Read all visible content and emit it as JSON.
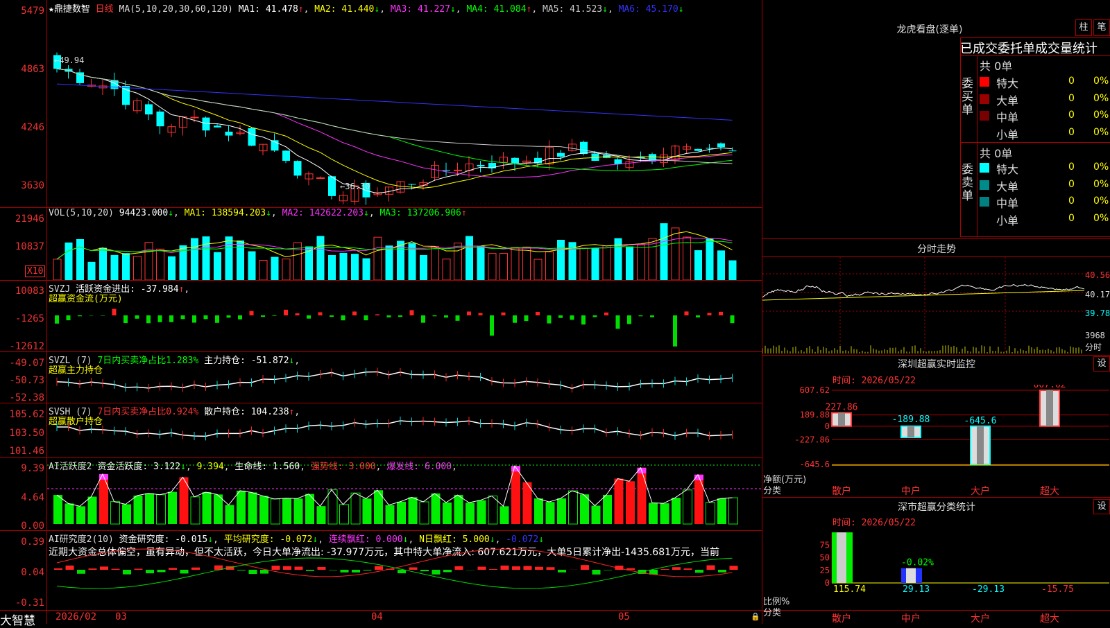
{
  "stock": {
    "name": "★鼎捷数智",
    "period": "日线",
    "ma_label": "MA(5,10,20,30,60,120)"
  },
  "ma": {
    "ma1": "MA1: 41.478",
    "ma2": "MA2: 41.440",
    "ma3": "MA3: 41.227",
    "ma4": "MA4: 41.084",
    "ma5": "MA5: 41.523",
    "ma6": "MA6: 45.170",
    "colors": {
      "ma1": "#ffffff",
      "ma2": "#ffff00",
      "ma3": "#ff33ff",
      "ma4": "#00ff00",
      "ma5": "#cccccc",
      "ma6": "#3333ff"
    }
  },
  "price_axis": [
    "5479",
    "4863",
    "4246",
    "3630"
  ],
  "price_annotations": {
    "high": "49.94",
    "low": "36.30"
  },
  "vol": {
    "header": "VOL(5,10,20)",
    "value": "94423.000",
    "ma1": "MA1: 138594.203",
    "ma2": "MA2: 142622.203",
    "ma3": "MA3: 137206.906",
    "axis": [
      "21946",
      "10837"
    ],
    "unit": "X10"
  },
  "svzj": {
    "header": "SVZJ",
    "label": "活跃资金进出: -37.984",
    "sublabel": "超赢资金流(万元)",
    "axis": [
      "10083",
      "-1265",
      "-12612"
    ]
  },
  "svzl": {
    "header": "SVZL (7)",
    "label1": "7日内买卖净占比1.283%",
    "label2": "主力持仓: -51.872",
    "sublabel": "超赢主力持仓",
    "axis": [
      "-49.07",
      "-50.73",
      "-52.38"
    ]
  },
  "svsh": {
    "header": "SVSH (7)",
    "label1": "7日内买卖净占比0.924%",
    "label2": "散户持仓: 104.238",
    "sublabel": "超赢散户持仓",
    "axis": [
      "105.62",
      "103.50",
      "101.46"
    ]
  },
  "ai_active": {
    "header": "AI活跃度2",
    "label": "资金活跃度: 3.122",
    "v2": "9.394",
    "life": "生命线: 1.560",
    "strong": "强势线: 3.000",
    "burst": "爆发线: 6.000",
    "axis": [
      "9.39",
      "4.64",
      "0.00"
    ]
  },
  "ai_research": {
    "header": "AI研究度2(10)",
    "label": "资金研究度: -0.015",
    "avg": "平均研究度: -0.072",
    "red": "连续飘红: 0.000",
    "nred": "N日飘红: 5.000",
    "extra": "-0.072",
    "comment": "近期大资金总体偏空，虽有异动，但不太活跃，今日大单净流出: -37.977万元，其中特大单净流入: 607.621万元，大单5日累计净出-1435.681万元，当前",
    "axis": [
      "0.39",
      "0.04",
      "-0.31"
    ]
  },
  "date_axis": {
    "brand": "大智慧",
    "labels": [
      "2026/02",
      "03",
      "04",
      "05"
    ]
  },
  "dragon": {
    "title": "龙虎看盘(逐单)",
    "tab1": "柱",
    "tab2": "笔",
    "subtitle": "已成交委托单成交量统计",
    "buy": {
      "side": "委买单",
      "total": "共 0单",
      "rows": [
        {
          "label": "特大",
          "count": "0",
          "pct": "0%",
          "color": "#ff0000"
        },
        {
          "label": "大单",
          "count": "0",
          "pct": "0%",
          "color": "#990000"
        },
        {
          "label": "中单",
          "count": "0",
          "pct": "0%",
          "color": "#770000"
        },
        {
          "label": "小单",
          "count": "0",
          "pct": "0%",
          "color": ""
        }
      ]
    },
    "sell": {
      "side": "委卖单",
      "total": "共 0单",
      "rows": [
        {
          "label": "特大",
          "count": "0",
          "pct": "0%",
          "color": "#00ffff"
        },
        {
          "label": "大单",
          "count": "0",
          "pct": "0%",
          "color": "#008b8b"
        },
        {
          "label": "中单",
          "count": "0",
          "pct": "0%",
          "color": "#008080"
        },
        {
          "label": "小单",
          "count": "0",
          "pct": "0%",
          "color": ""
        }
      ]
    }
  },
  "intraday": {
    "title": "分时走势",
    "axis": [
      "40.56",
      "40.17",
      "39.78"
    ],
    "vol_axis": "3968",
    "vol_unit": "分时"
  },
  "realtime": {
    "title": "深圳超赢实时监控",
    "settings": "设",
    "time": "时间: 2026/05/22",
    "axis": [
      "607.62",
      "189.88",
      "0",
      "-227.86",
      "-645.6"
    ],
    "ylabel": "净额(万元)",
    "xlabel": "分类",
    "chart_data": {
      "type": "bar",
      "categories": [
        "散户",
        "中户",
        "大户",
        "超大"
      ],
      "values": [
        227.86,
        -189.88,
        -645.6,
        607.62
      ],
      "labels": [
        "227.86",
        "-189.88",
        "-645.6",
        "607.62"
      ],
      "ylim": [
        -645.6,
        607.62
      ]
    }
  },
  "classify": {
    "title": "深市超赢分类统计",
    "settings": "设",
    "time": "时间: 2026/05/22",
    "axis": [
      "75",
      "50",
      "25",
      "0"
    ],
    "ylabel": "比例%",
    "xlabel": "分类",
    "chart_data": {
      "type": "bar",
      "categories": [
        "散户",
        "中户",
        "大户",
        "超大"
      ],
      "values": [
        115.74,
        29.13,
        -29.13,
        -15.75
      ],
      "labels": [
        "115.74",
        "29.13",
        "-29.13",
        "-15.75"
      ],
      "bar_label": "-0.02%",
      "ylim": [
        0,
        100
      ]
    }
  }
}
